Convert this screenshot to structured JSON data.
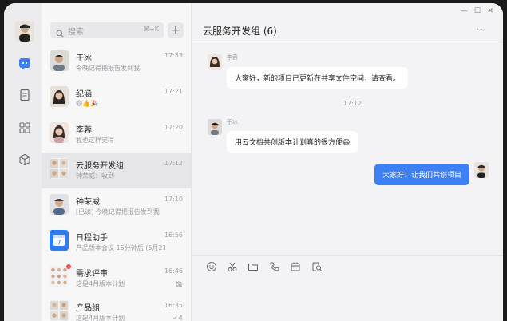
{
  "search": {
    "placeholder": "搜索",
    "shortcut": "⌘+K"
  },
  "chats": [
    {
      "name": "于冰",
      "preview": "今晚记得把报告发到我",
      "time": "17:53"
    },
    {
      "name": "纪涵",
      "preview": "😄👍🎉",
      "time": "17:21"
    },
    {
      "name": "李蓉",
      "preview": "我也这样觉得",
      "time": "17:20"
    },
    {
      "name": "云服务开发组",
      "preview": "钟荣威：收到",
      "time": "17:12"
    },
    {
      "name": "钟荣威",
      "preview": "[已读] 今晚记得把报告发到我",
      "time": "17:10"
    },
    {
      "name": "日程助手",
      "preview": "产品版本会议 15分钟后 (5月21...",
      "time": "16:56"
    },
    {
      "name": "需求评审",
      "preview": "这是4月版本计划",
      "time": "16:46"
    },
    {
      "name": "产品组",
      "preview": "这是4月版本计划",
      "time": "16:35",
      "badge": "4"
    }
  ],
  "calendar_day": "7",
  "chat": {
    "title": "云服务开发组",
    "member_count": "(6)",
    "messages": [
      {
        "sender": "李蓉",
        "text": "大家好，新的项目已更新在共享文件空间，请查看。"
      },
      {
        "sender": "于冰",
        "text": "用云文档共创版本计划真的很方便😄"
      },
      {
        "text": "大家好！让我们共创项目"
      }
    ],
    "timestamp": "17:12"
  },
  "colors": {
    "accent": "#3d7ff5",
    "unread": "#f14c4c"
  }
}
